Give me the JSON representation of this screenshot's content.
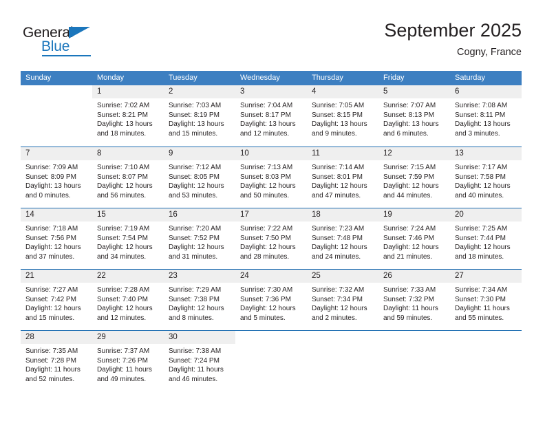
{
  "brand": {
    "name_part1": "General",
    "name_part2": "Blue",
    "accent_color": "#1b76bc"
  },
  "header": {
    "title": "September 2025",
    "subtitle": "Cogny, France"
  },
  "calendar": {
    "header_bg": "#3d7fc1",
    "row_divider_color": "#1a6bb0",
    "daynum_band_bg": "#efefef",
    "weekday_headers": [
      "Sunday",
      "Monday",
      "Tuesday",
      "Wednesday",
      "Thursday",
      "Friday",
      "Saturday"
    ],
    "weeks": [
      [
        {
          "day": "",
          "empty": true,
          "sunrise": "",
          "sunset": "",
          "daylight_line1": "",
          "daylight_line2": ""
        },
        {
          "day": "1",
          "empty": false,
          "sunrise": "Sunrise: 7:02 AM",
          "sunset": "Sunset: 8:21 PM",
          "daylight_line1": "Daylight: 13 hours",
          "daylight_line2": "and 18 minutes."
        },
        {
          "day": "2",
          "empty": false,
          "sunrise": "Sunrise: 7:03 AM",
          "sunset": "Sunset: 8:19 PM",
          "daylight_line1": "Daylight: 13 hours",
          "daylight_line2": "and 15 minutes."
        },
        {
          "day": "3",
          "empty": false,
          "sunrise": "Sunrise: 7:04 AM",
          "sunset": "Sunset: 8:17 PM",
          "daylight_line1": "Daylight: 13 hours",
          "daylight_line2": "and 12 minutes."
        },
        {
          "day": "4",
          "empty": false,
          "sunrise": "Sunrise: 7:05 AM",
          "sunset": "Sunset: 8:15 PM",
          "daylight_line1": "Daylight: 13 hours",
          "daylight_line2": "and 9 minutes."
        },
        {
          "day": "5",
          "empty": false,
          "sunrise": "Sunrise: 7:07 AM",
          "sunset": "Sunset: 8:13 PM",
          "daylight_line1": "Daylight: 13 hours",
          "daylight_line2": "and 6 minutes."
        },
        {
          "day": "6",
          "empty": false,
          "sunrise": "Sunrise: 7:08 AM",
          "sunset": "Sunset: 8:11 PM",
          "daylight_line1": "Daylight: 13 hours",
          "daylight_line2": "and 3 minutes."
        }
      ],
      [
        {
          "day": "7",
          "empty": false,
          "sunrise": "Sunrise: 7:09 AM",
          "sunset": "Sunset: 8:09 PM",
          "daylight_line1": "Daylight: 13 hours",
          "daylight_line2": "and 0 minutes."
        },
        {
          "day": "8",
          "empty": false,
          "sunrise": "Sunrise: 7:10 AM",
          "sunset": "Sunset: 8:07 PM",
          "daylight_line1": "Daylight: 12 hours",
          "daylight_line2": "and 56 minutes."
        },
        {
          "day": "9",
          "empty": false,
          "sunrise": "Sunrise: 7:12 AM",
          "sunset": "Sunset: 8:05 PM",
          "daylight_line1": "Daylight: 12 hours",
          "daylight_line2": "and 53 minutes."
        },
        {
          "day": "10",
          "empty": false,
          "sunrise": "Sunrise: 7:13 AM",
          "sunset": "Sunset: 8:03 PM",
          "daylight_line1": "Daylight: 12 hours",
          "daylight_line2": "and 50 minutes."
        },
        {
          "day": "11",
          "empty": false,
          "sunrise": "Sunrise: 7:14 AM",
          "sunset": "Sunset: 8:01 PM",
          "daylight_line1": "Daylight: 12 hours",
          "daylight_line2": "and 47 minutes."
        },
        {
          "day": "12",
          "empty": false,
          "sunrise": "Sunrise: 7:15 AM",
          "sunset": "Sunset: 7:59 PM",
          "daylight_line1": "Daylight: 12 hours",
          "daylight_line2": "and 44 minutes."
        },
        {
          "day": "13",
          "empty": false,
          "sunrise": "Sunrise: 7:17 AM",
          "sunset": "Sunset: 7:58 PM",
          "daylight_line1": "Daylight: 12 hours",
          "daylight_line2": "and 40 minutes."
        }
      ],
      [
        {
          "day": "14",
          "empty": false,
          "sunrise": "Sunrise: 7:18 AM",
          "sunset": "Sunset: 7:56 PM",
          "daylight_line1": "Daylight: 12 hours",
          "daylight_line2": "and 37 minutes."
        },
        {
          "day": "15",
          "empty": false,
          "sunrise": "Sunrise: 7:19 AM",
          "sunset": "Sunset: 7:54 PM",
          "daylight_line1": "Daylight: 12 hours",
          "daylight_line2": "and 34 minutes."
        },
        {
          "day": "16",
          "empty": false,
          "sunrise": "Sunrise: 7:20 AM",
          "sunset": "Sunset: 7:52 PM",
          "daylight_line1": "Daylight: 12 hours",
          "daylight_line2": "and 31 minutes."
        },
        {
          "day": "17",
          "empty": false,
          "sunrise": "Sunrise: 7:22 AM",
          "sunset": "Sunset: 7:50 PM",
          "daylight_line1": "Daylight: 12 hours",
          "daylight_line2": "and 28 minutes."
        },
        {
          "day": "18",
          "empty": false,
          "sunrise": "Sunrise: 7:23 AM",
          "sunset": "Sunset: 7:48 PM",
          "daylight_line1": "Daylight: 12 hours",
          "daylight_line2": "and 24 minutes."
        },
        {
          "day": "19",
          "empty": false,
          "sunrise": "Sunrise: 7:24 AM",
          "sunset": "Sunset: 7:46 PM",
          "daylight_line1": "Daylight: 12 hours",
          "daylight_line2": "and 21 minutes."
        },
        {
          "day": "20",
          "empty": false,
          "sunrise": "Sunrise: 7:25 AM",
          "sunset": "Sunset: 7:44 PM",
          "daylight_line1": "Daylight: 12 hours",
          "daylight_line2": "and 18 minutes."
        }
      ],
      [
        {
          "day": "21",
          "empty": false,
          "sunrise": "Sunrise: 7:27 AM",
          "sunset": "Sunset: 7:42 PM",
          "daylight_line1": "Daylight: 12 hours",
          "daylight_line2": "and 15 minutes."
        },
        {
          "day": "22",
          "empty": false,
          "sunrise": "Sunrise: 7:28 AM",
          "sunset": "Sunset: 7:40 PM",
          "daylight_line1": "Daylight: 12 hours",
          "daylight_line2": "and 12 minutes."
        },
        {
          "day": "23",
          "empty": false,
          "sunrise": "Sunrise: 7:29 AM",
          "sunset": "Sunset: 7:38 PM",
          "daylight_line1": "Daylight: 12 hours",
          "daylight_line2": "and 8 minutes."
        },
        {
          "day": "24",
          "empty": false,
          "sunrise": "Sunrise: 7:30 AM",
          "sunset": "Sunset: 7:36 PM",
          "daylight_line1": "Daylight: 12 hours",
          "daylight_line2": "and 5 minutes."
        },
        {
          "day": "25",
          "empty": false,
          "sunrise": "Sunrise: 7:32 AM",
          "sunset": "Sunset: 7:34 PM",
          "daylight_line1": "Daylight: 12 hours",
          "daylight_line2": "and 2 minutes."
        },
        {
          "day": "26",
          "empty": false,
          "sunrise": "Sunrise: 7:33 AM",
          "sunset": "Sunset: 7:32 PM",
          "daylight_line1": "Daylight: 11 hours",
          "daylight_line2": "and 59 minutes."
        },
        {
          "day": "27",
          "empty": false,
          "sunrise": "Sunrise: 7:34 AM",
          "sunset": "Sunset: 7:30 PM",
          "daylight_line1": "Daylight: 11 hours",
          "daylight_line2": "and 55 minutes."
        }
      ],
      [
        {
          "day": "28",
          "empty": false,
          "sunrise": "Sunrise: 7:35 AM",
          "sunset": "Sunset: 7:28 PM",
          "daylight_line1": "Daylight: 11 hours",
          "daylight_line2": "and 52 minutes."
        },
        {
          "day": "29",
          "empty": false,
          "sunrise": "Sunrise: 7:37 AM",
          "sunset": "Sunset: 7:26 PM",
          "daylight_line1": "Daylight: 11 hours",
          "daylight_line2": "and 49 minutes."
        },
        {
          "day": "30",
          "empty": false,
          "sunrise": "Sunrise: 7:38 AM",
          "sunset": "Sunset: 7:24 PM",
          "daylight_line1": "Daylight: 11 hours",
          "daylight_line2": "and 46 minutes."
        },
        {
          "day": "",
          "empty": true,
          "sunrise": "",
          "sunset": "",
          "daylight_line1": "",
          "daylight_line2": ""
        },
        {
          "day": "",
          "empty": true,
          "sunrise": "",
          "sunset": "",
          "daylight_line1": "",
          "daylight_line2": ""
        },
        {
          "day": "",
          "empty": true,
          "sunrise": "",
          "sunset": "",
          "daylight_line1": "",
          "daylight_line2": ""
        },
        {
          "day": "",
          "empty": true,
          "sunrise": "",
          "sunset": "",
          "daylight_line1": "",
          "daylight_line2": ""
        }
      ]
    ]
  }
}
